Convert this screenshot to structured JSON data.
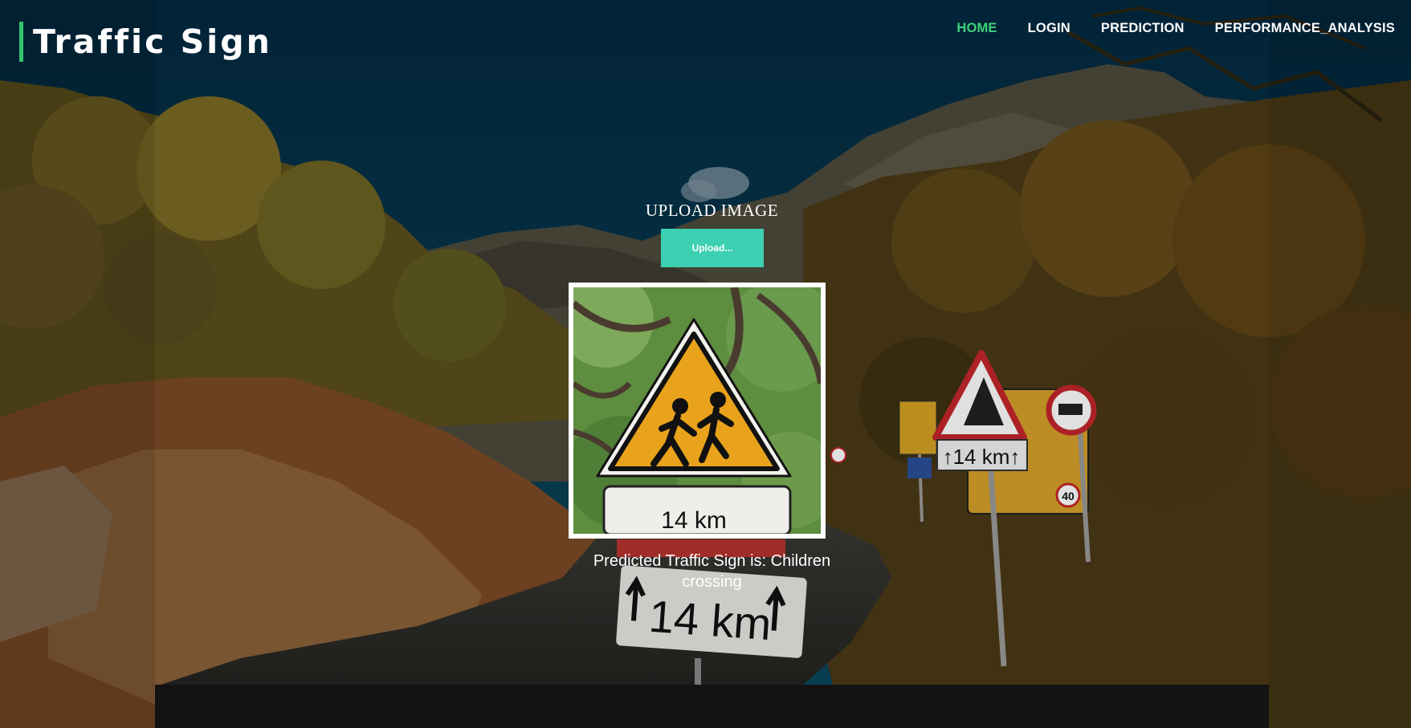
{
  "header": {
    "brand": "Traffic Sign",
    "accent_color": "#34c66b"
  },
  "nav": {
    "items": [
      {
        "label": "HOME",
        "active": true
      },
      {
        "label": "LOGIN",
        "active": false
      },
      {
        "label": "PREDICTION",
        "active": false
      },
      {
        "label": "PERFORMANCE_ANALYSIS",
        "active": false
      }
    ],
    "active_color": "#3fd17a"
  },
  "upload": {
    "title": "UPLOAD IMAGE",
    "button_label": "Upload...",
    "button_color": "#3ccfb1"
  },
  "preview": {
    "sign_distance_text": "14 km"
  },
  "result": {
    "text": "Predicted Traffic Sign is: Children crossing"
  },
  "background_scene": {
    "sign_distance_text": "14 km",
    "speed_limit": "40"
  }
}
